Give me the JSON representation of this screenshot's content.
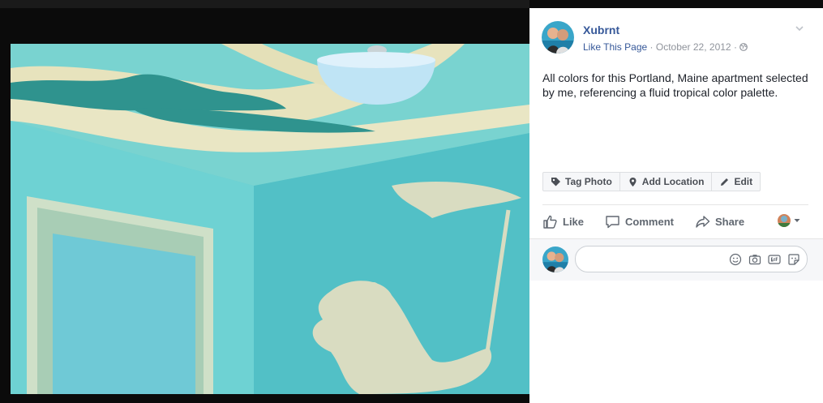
{
  "post": {
    "author": "Xubrnt",
    "like_page": "Like This Page",
    "separator": "·",
    "date": "October 22, 2012",
    "privacy_icon": "globe-icon",
    "caption": "All colors for this Portland, Maine apartment selected by me, referencing a fluid tropical color palette."
  },
  "photo_tools": [
    {
      "label": "Tag Photo",
      "icon": "tag-icon"
    },
    {
      "label": "Add Location",
      "icon": "location-pin-icon"
    },
    {
      "label": "Edit",
      "icon": "pencil-icon"
    }
  ],
  "actions": [
    {
      "label": "Like",
      "icon": "thumbs-up-icon"
    },
    {
      "label": "Comment",
      "icon": "comment-icon"
    },
    {
      "label": "Share",
      "icon": "share-icon"
    }
  ],
  "comment": {
    "placeholder": "",
    "icons": [
      "emoji-icon",
      "camera-icon",
      "gif-icon",
      "sticker-icon"
    ]
  },
  "colors": {
    "link": "#365899",
    "wall": "#5cc9cc",
    "ceiling_trim": "#e9e6c4",
    "ceiling_dark": "#2a8f8a"
  }
}
